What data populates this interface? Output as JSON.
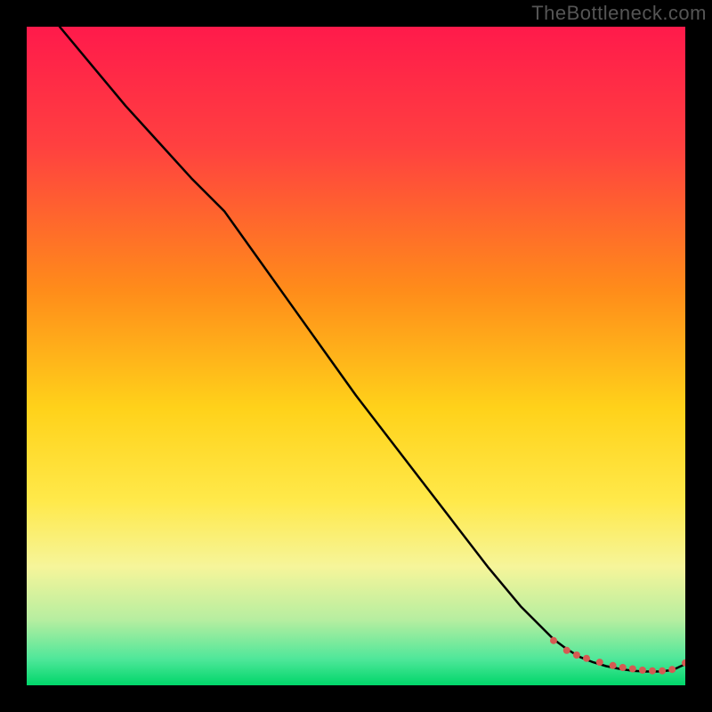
{
  "watermark": "TheBottleneck.com",
  "colors": {
    "frame_bg": "#000000",
    "gradient_stops": [
      {
        "pct": 0,
        "color": "#ff1a4b"
      },
      {
        "pct": 18,
        "color": "#ff4040"
      },
      {
        "pct": 40,
        "color": "#ff8c1a"
      },
      {
        "pct": 58,
        "color": "#ffd21a"
      },
      {
        "pct": 72,
        "color": "#ffe94a"
      },
      {
        "pct": 82,
        "color": "#f6f59a"
      },
      {
        "pct": 90,
        "color": "#b7eea0"
      },
      {
        "pct": 96,
        "color": "#4fe79a"
      },
      {
        "pct": 100,
        "color": "#00d66a"
      }
    ],
    "curve_stroke": "#000000",
    "marker_fill": "#d55a52"
  },
  "chart_data": {
    "type": "line",
    "title": "",
    "xlabel": "",
    "ylabel": "",
    "xlim": [
      0,
      100
    ],
    "ylim": [
      0,
      100
    ],
    "grid": false,
    "legend": false,
    "series": [
      {
        "name": "curve",
        "x": [
          5,
          10,
          15,
          20,
          25,
          30,
          35,
          40,
          45,
          50,
          55,
          60,
          65,
          70,
          75,
          80,
          82,
          84,
          86,
          88,
          90,
          92,
          94,
          96,
          98,
          100
        ],
        "values": [
          100,
          94,
          88,
          82.5,
          77,
          72,
          65,
          58,
          51,
          44,
          37.5,
          31,
          24.5,
          18,
          12,
          7,
          5.5,
          4.3,
          3.5,
          2.9,
          2.5,
          2.2,
          2.1,
          2.1,
          2.3,
          3.2
        ]
      }
    ],
    "markers": {
      "name": "highlight-cluster",
      "x": [
        80,
        82,
        83.5,
        85,
        87,
        89,
        90.5,
        92,
        93.5,
        95,
        96.5,
        98,
        100
      ],
      "values": [
        6.8,
        5.3,
        4.6,
        4.1,
        3.5,
        3.0,
        2.7,
        2.5,
        2.3,
        2.2,
        2.2,
        2.4,
        3.4
      ],
      "radius": 4
    }
  }
}
